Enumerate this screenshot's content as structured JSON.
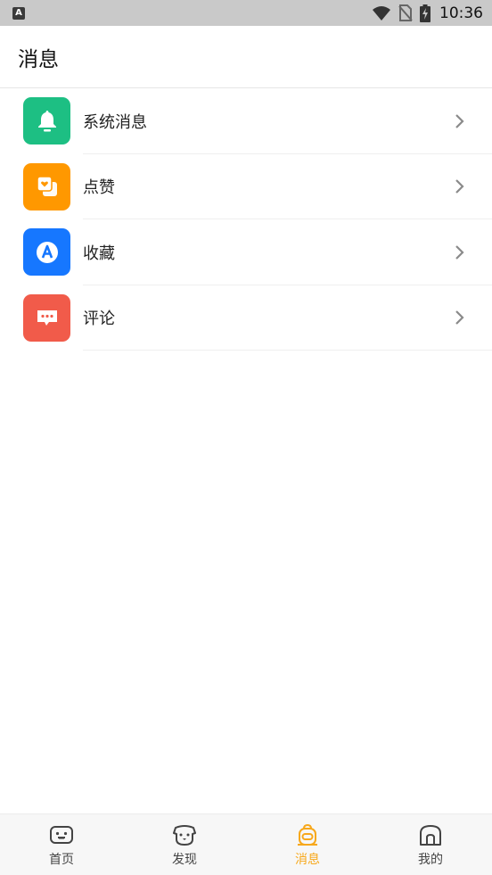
{
  "status_bar": {
    "app_badge": "A",
    "time": "10:36"
  },
  "header": {
    "title": "消息"
  },
  "list": {
    "items": [
      {
        "label": "系统消息",
        "icon": "bell-icon",
        "color": "#1dbf83"
      },
      {
        "label": "点赞",
        "icon": "like-card-icon",
        "color": "#ff9800"
      },
      {
        "label": "收藏",
        "icon": "favorite-a-icon",
        "color": "#1677ff"
      },
      {
        "label": "评论",
        "icon": "comment-bubble-icon",
        "color": "#f15b4a"
      }
    ]
  },
  "tabbar": {
    "active_color": "#f7a81b",
    "tabs": [
      {
        "label": "首页",
        "icon": "home-face-icon",
        "active": false
      },
      {
        "label": "发现",
        "icon": "discover-dog-icon",
        "active": false
      },
      {
        "label": "消息",
        "icon": "message-bag-icon",
        "active": true
      },
      {
        "label": "我的",
        "icon": "profile-house-icon",
        "active": false
      }
    ]
  }
}
